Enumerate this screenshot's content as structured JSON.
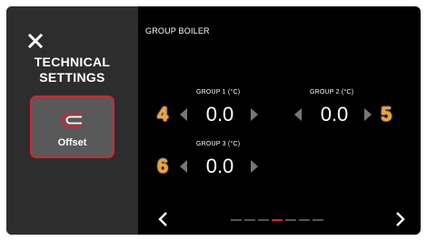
{
  "sidebar": {
    "title": "TECHNICAL\nSETTINGS",
    "card_label": "Offset"
  },
  "main": {
    "title": "GROUP BOILER",
    "groups": [
      {
        "label": "GROUP 1 (°C)",
        "value": "0.0",
        "badge": "4"
      },
      {
        "label": "GROUP 2 (°C)",
        "value": "0.0",
        "badge": "5"
      },
      {
        "label": "GROUP 3 (°C)",
        "value": "0.0",
        "badge": "6"
      }
    ]
  },
  "pager": {
    "pages": 7,
    "active": 3
  },
  "colors": {
    "accent": "#d6222e",
    "badge": "#ff9c1f",
    "sidebar": "#2d2d2d",
    "card": "#595959"
  },
  "icons": {
    "close": "close-icon",
    "offset": "offset-icon"
  }
}
